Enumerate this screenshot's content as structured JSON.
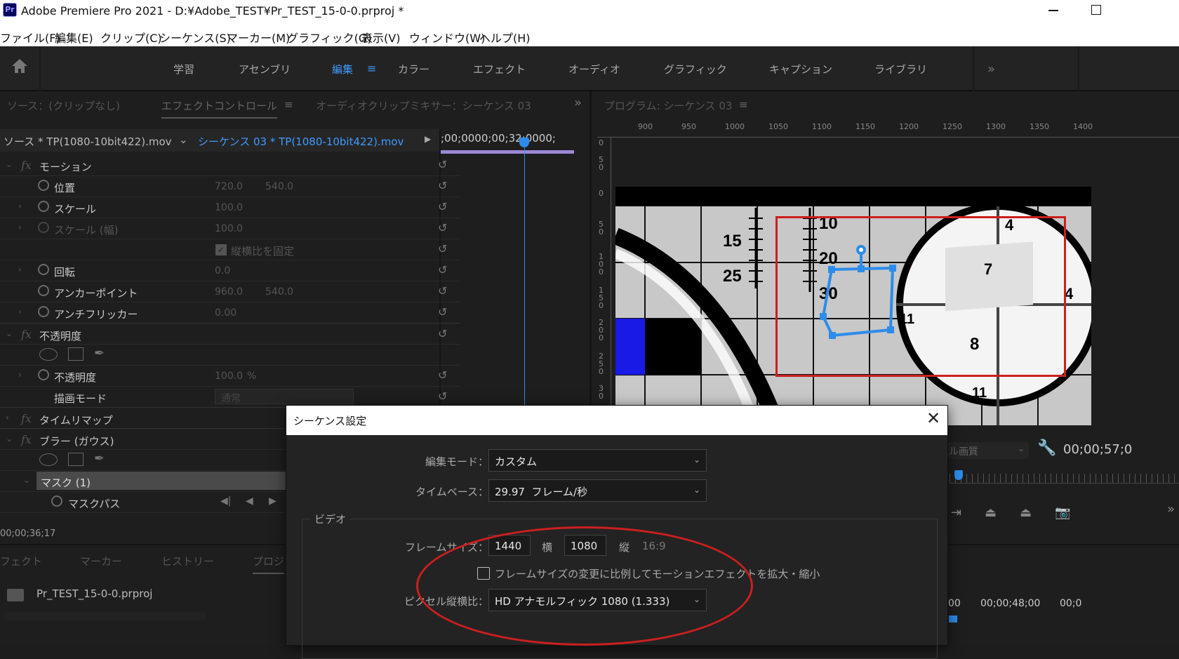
{
  "window": {
    "title": "Adobe Premiere Pro 2021 - D:¥Adobe_TEST¥Pr_TEST_15-0-0.prproj *",
    "app_icon": "Pr"
  },
  "menu": [
    "ファイル(F)",
    "編集(E)",
    "クリップ(C)",
    "シーケンス(S)",
    "マーカー(M)",
    "グラフィック(G)",
    "表示(V)",
    "ウィンドウ(W)",
    "ヘルプ(H)"
  ],
  "workspaces": [
    "学習",
    "アセンブリ",
    "編集",
    "カラー",
    "エフェクト",
    "オーディオ",
    "グラフィック",
    "キャプション",
    "ライブラリ"
  ],
  "active_workspace": "編集",
  "left_tabs": {
    "source": "ソース：(クリップなし)",
    "effect_controls": "エフェクトコントロール",
    "audio_mixer": "オーディオクリップミキサー：シーケンス 03"
  },
  "clip_bar": {
    "source_clip": "ソース * TP(1080-10bit422).mov",
    "sequence_clip": "シーケンス 03 * TP(1080-10bit422).mov",
    "timecode_strip": ";00;0000;00;32;0000;"
  },
  "effects": {
    "motion": "モーション",
    "position": {
      "label": "位置",
      "x": "720.0",
      "y": "540.0"
    },
    "scale": {
      "label": "スケール",
      "value": "100.0"
    },
    "scale_width": {
      "label": "スケール (幅)",
      "value": "100.0"
    },
    "uniform_scale": "縦横比を固定",
    "rotation": {
      "label": "回転",
      "value": "0.0"
    },
    "anchor": {
      "label": "アンカーポイント",
      "x": "960.0",
      "y": "540.0"
    },
    "antiflicker": {
      "label": "アンチフリッカー",
      "value": "0.00"
    },
    "opacity_section": "不透明度",
    "opacity": {
      "label": "不透明度",
      "value": "100.0",
      "unit": "%"
    },
    "blend_mode": {
      "label": "描画モード",
      "value": "通常"
    },
    "time_remap": "タイムリマップ",
    "blur": "ブラー (ガウス)",
    "mask": "マスク (1)",
    "mask_path": "マスクパス"
  },
  "left_timecode": "00;00;36;17",
  "bottom_tabs": [
    "フェクト",
    "マーカー",
    "ヒストリー",
    "プロジ"
  ],
  "project_file": "Pr_TEST_15-0-0.prproj",
  "program": {
    "title": "プログラム: シーケンス 03",
    "ruler_h": [
      "900",
      "950",
      "1000",
      "1050",
      "1100",
      "1150",
      "1200",
      "1250",
      "1300",
      "1350",
      "1400"
    ],
    "ruler_v": [
      "0",
      "5 0",
      "0",
      "5 0",
      "1 0 0",
      "1 5 0",
      "2 0 0",
      "2 5 0",
      "3 0"
    ],
    "chart_numbers": [
      "15",
      "25",
      "10",
      "20",
      "30",
      "4",
      "7",
      "4",
      "11",
      "8",
      "11"
    ],
    "quality": "ル画質",
    "timecode": "00;00;57;0",
    "timeline_tc1": "00",
    "timeline_tc2": "00;00;48;00",
    "timeline_tc3": "00;0"
  },
  "dialog": {
    "title": "シーケンス設定",
    "edit_mode": {
      "label": "編集モード：",
      "value": "カスタム"
    },
    "timebase": {
      "label": "タイムベース：",
      "value": "29.97  フレーム/秒"
    },
    "video_section": "ビデオ",
    "frame_size": {
      "label": "フレームサイズ：",
      "width": "1440",
      "w_label": "横",
      "height": "1080",
      "h_label": "縦",
      "ratio": "16:9"
    },
    "scale_checkbox": "フレームサイズの変更に比例してモーションエフェクトを拡大・縮小",
    "pixel_aspect": {
      "label": "ピクセル縦横比：",
      "value": "HD アナモルフィック 1080 (1.333)"
    }
  },
  "colors": {
    "accent": "#2d8ceb",
    "annotation": "#cc1f1f",
    "timeline_bar": "#9b87d8"
  }
}
